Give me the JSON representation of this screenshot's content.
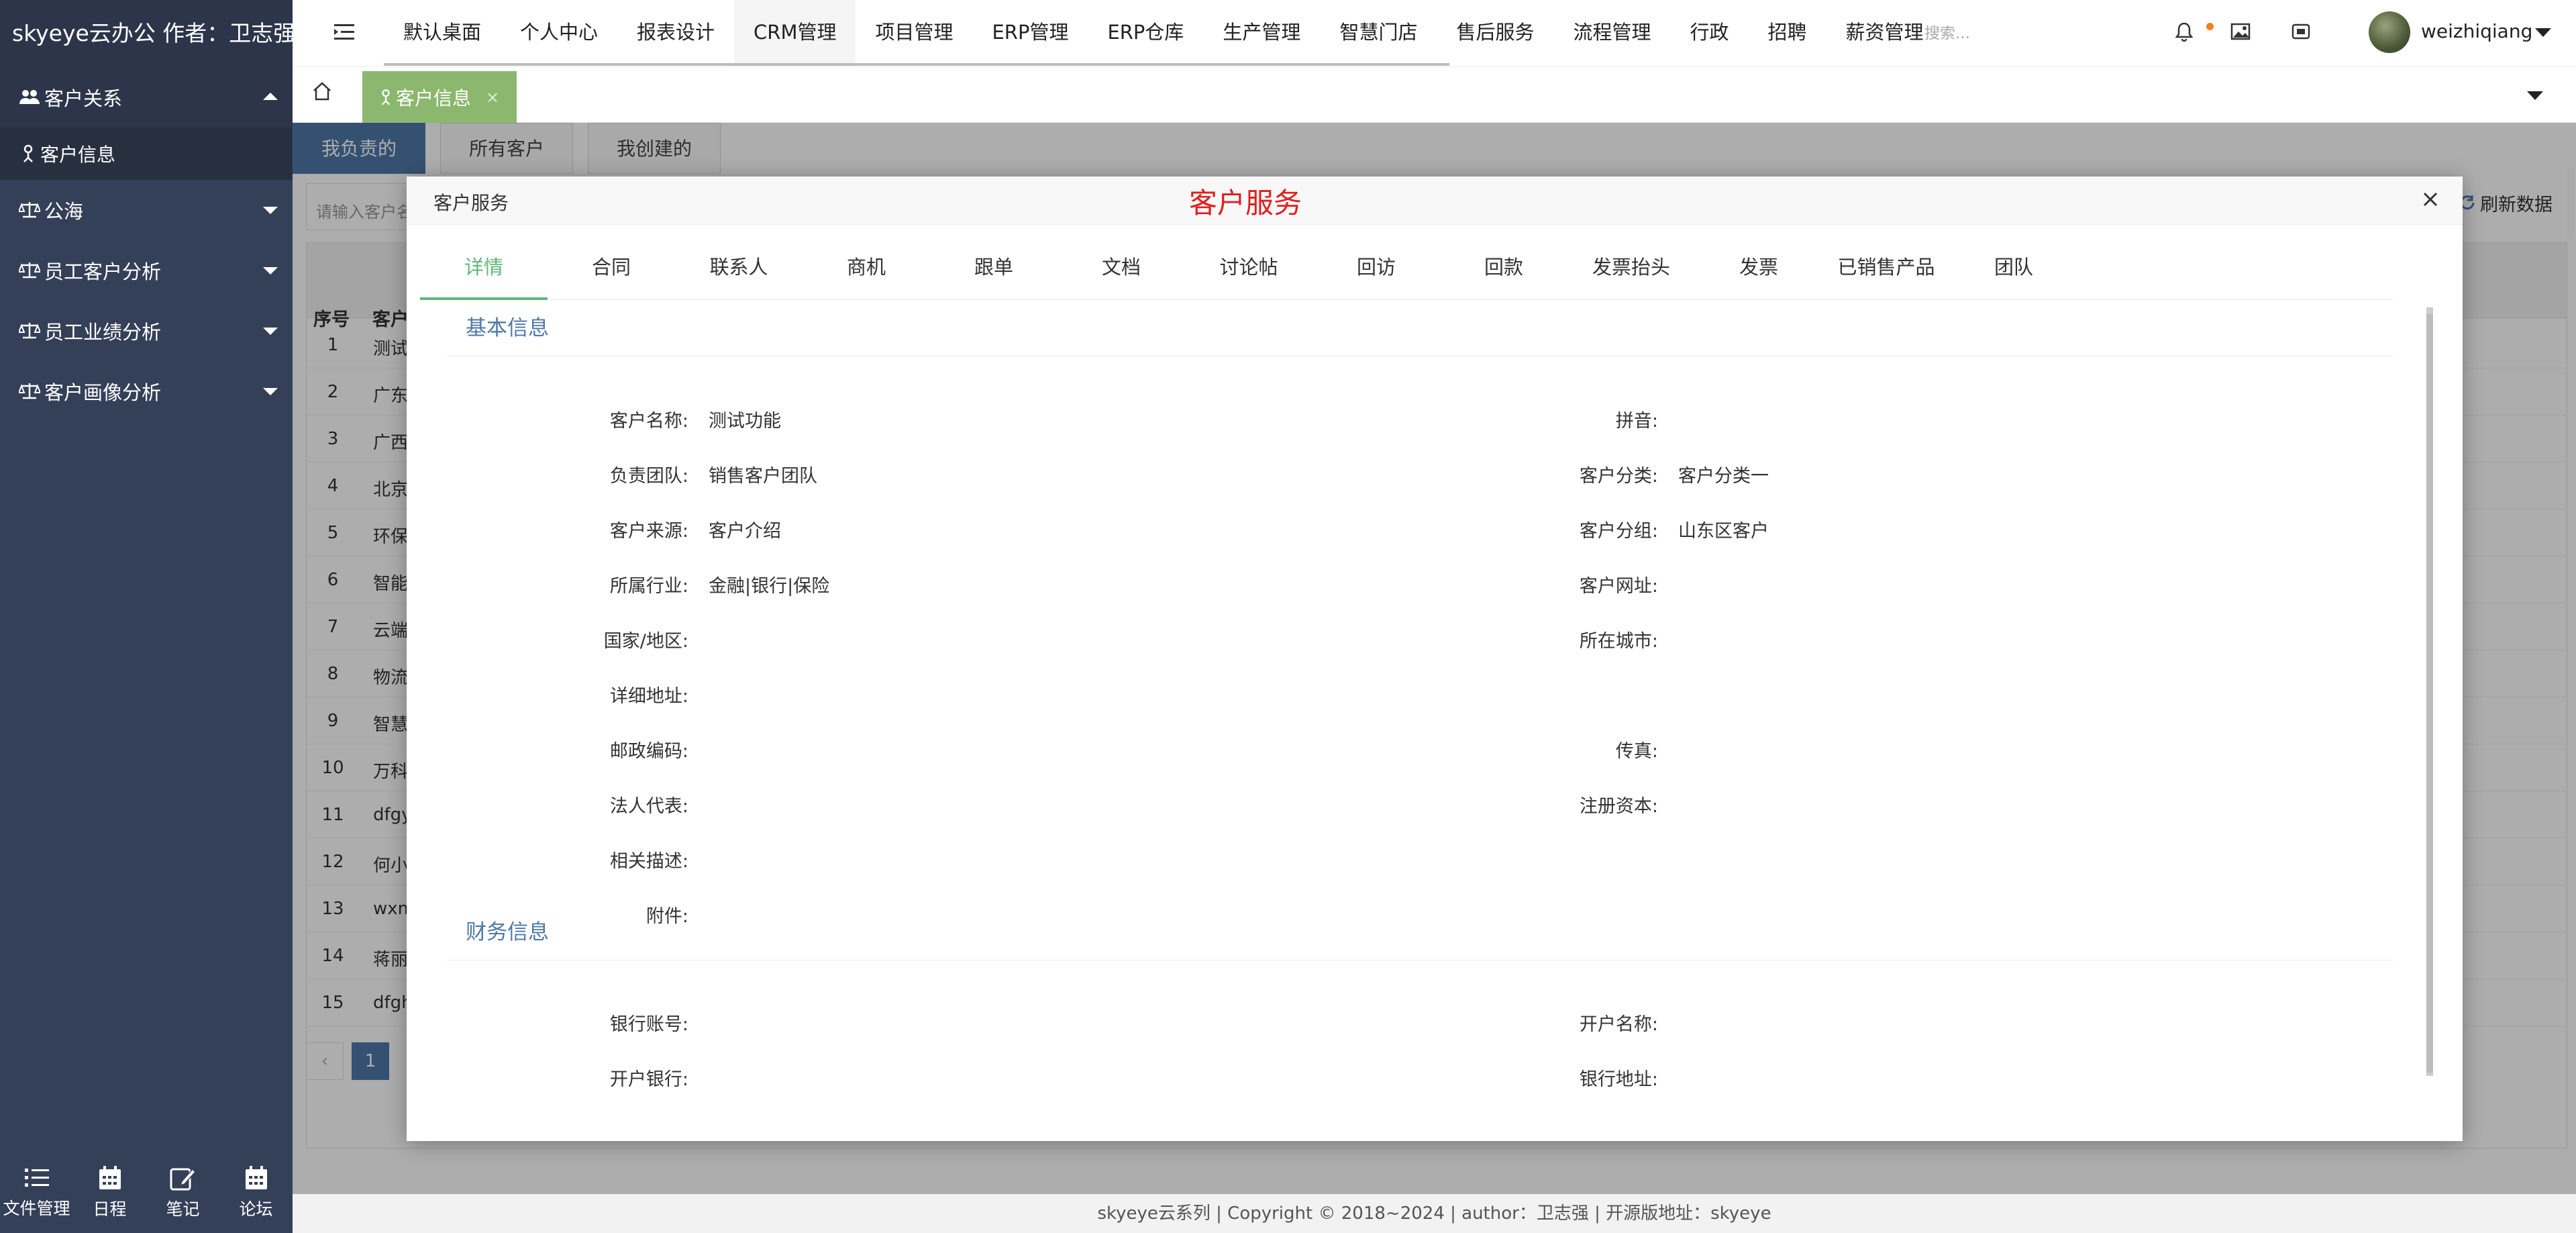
{
  "app": {
    "brand": "skyeye云办公 作者：卫志强"
  },
  "sidebar": {
    "groups": [
      {
        "label": "客户关系",
        "icon": "users-icon",
        "expanded": true,
        "items": [
          {
            "label": "客户信息",
            "icon": "person-icon"
          }
        ]
      },
      {
        "label": "公海",
        "icon": "scale-icon"
      },
      {
        "label": "员工客户分析",
        "icon": "scale-icon"
      },
      {
        "label": "员工业绩分析",
        "icon": "scale-icon"
      },
      {
        "label": "客户画像分析",
        "icon": "scale-icon"
      }
    ],
    "bottom": [
      {
        "label": "文件管理",
        "icon": "list-icon"
      },
      {
        "label": "日程",
        "icon": "calendar-icon"
      },
      {
        "label": "笔记",
        "icon": "edit-icon"
      },
      {
        "label": "论坛",
        "icon": "calendar-icon"
      }
    ]
  },
  "topnav": {
    "tabs": [
      "默认桌面",
      "个人中心",
      "报表设计",
      "CRM管理",
      "项目管理",
      "ERP管理",
      "ERP仓库",
      "生产管理",
      "智慧门店",
      "售后服务",
      "流程管理",
      "行政",
      "招聘",
      "薪资管理"
    ],
    "active": "CRM管理",
    "search_placeholder": "搜索...",
    "username": "weizhiqiang(..."
  },
  "pagetabs": {
    "current": "客户信息",
    "close": "×"
  },
  "list": {
    "subtabs": [
      "我负责的",
      "所有客户",
      "我创建的"
    ],
    "filter_placeholder": "请输入客户名称",
    "refresh_label": "刷新数据",
    "columns": [
      "序号",
      "客户"
    ],
    "rows": [
      {
        "no": "1",
        "name": "测试"
      },
      {
        "no": "2",
        "name": "广东"
      },
      {
        "no": "3",
        "name": "广西"
      },
      {
        "no": "4",
        "name": "北京"
      },
      {
        "no": "5",
        "name": "环保"
      },
      {
        "no": "6",
        "name": "智能"
      },
      {
        "no": "7",
        "name": "云端"
      },
      {
        "no": "8",
        "name": "物流"
      },
      {
        "no": "9",
        "name": "智慧"
      },
      {
        "no": "10",
        "name": "万科"
      },
      {
        "no": "11",
        "name": "dfgy"
      },
      {
        "no": "12",
        "name": "何小"
      },
      {
        "no": "13",
        "name": "wxm"
      },
      {
        "no": "14",
        "name": "蒋丽"
      },
      {
        "no": "15",
        "name": "dfgh"
      }
    ],
    "page": "1"
  },
  "modal": {
    "title": "客户服务",
    "center_title": "客户服务",
    "tabs": [
      "详情",
      "合同",
      "联系人",
      "商机",
      "跟单",
      "文档",
      "讨论帖",
      "回访",
      "回款",
      "发票抬头",
      "发票",
      "已销售产品",
      "团队"
    ],
    "active_tab": "详情",
    "basic": {
      "title": "基本信息",
      "left": [
        {
          "label": "客户名称:",
          "value": "测试功能"
        },
        {
          "label": "负责团队:",
          "value": "销售客户团队"
        },
        {
          "label": "客户来源:",
          "value": "客户介绍"
        },
        {
          "label": "所属行业:",
          "value": "金融|银行|保险"
        },
        {
          "label": "国家/地区:",
          "value": ""
        },
        {
          "label": "详细地址:",
          "value": ""
        },
        {
          "label": "邮政编码:",
          "value": ""
        },
        {
          "label": "法人代表:",
          "value": ""
        },
        {
          "label": "相关描述:",
          "value": ""
        },
        {
          "label": "附件:",
          "value": ""
        }
      ],
      "right": [
        {
          "label": "拼音:",
          "value": ""
        },
        {
          "label": "客户分类:",
          "value": "客户分类一"
        },
        {
          "label": "客户分组:",
          "value": "山东区客户"
        },
        {
          "label": "客户网址:",
          "value": ""
        },
        {
          "label": "所在城市:",
          "value": ""
        },
        {
          "label": "",
          "value": ""
        },
        {
          "label": "传真:",
          "value": ""
        },
        {
          "label": "注册资本:",
          "value": ""
        }
      ]
    },
    "finance": {
      "title": "财务信息",
      "left": [
        {
          "label": "银行账号:",
          "value": ""
        },
        {
          "label": "开户银行:",
          "value": ""
        }
      ],
      "right": [
        {
          "label": "开户名称:",
          "value": ""
        },
        {
          "label": "银行地址:",
          "value": ""
        }
      ]
    }
  },
  "footer": {
    "text": "skyeye云系列 | Copyright © 2018~2024 | author：卫志强 | 开源版地址：skyeye"
  },
  "colors": {
    "sidebar": "#344058",
    "accent_green": "#5fb878",
    "tab_green": "#8bb86e",
    "blue": "#4e78a8",
    "red_title": "#e21d1d"
  }
}
